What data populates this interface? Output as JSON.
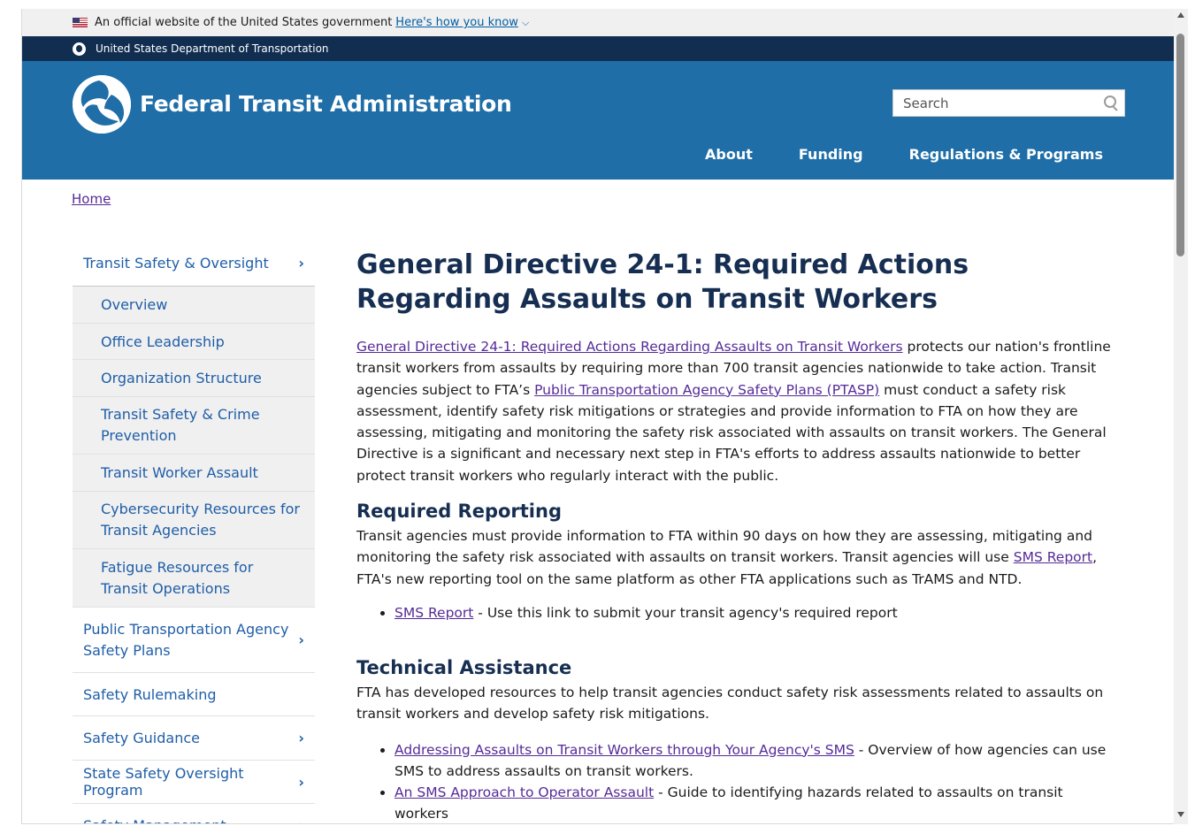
{
  "banner": {
    "official_text": "An official website of the United States government",
    "how_link": "Here's how you know"
  },
  "agency_bar": {
    "text": "United States Department of Transportation"
  },
  "header": {
    "site_name": "Federal Transit Administration",
    "search_placeholder": "Search",
    "nav": [
      "About",
      "Funding",
      "Regulations & Programs"
    ]
  },
  "breadcrumb": {
    "home": "Home"
  },
  "sidebar": {
    "section": "Transit Safety & Oversight",
    "subitems": [
      "Overview",
      "Office Leadership",
      "Organization Structure",
      "Transit Safety & Crime Prevention",
      "Transit Worker Assault",
      "Cybersecurity Resources for Transit Agencies",
      "Fatigue Resources for Transit Operations"
    ],
    "items": [
      {
        "label": "Public Transportation Agency Safety Plans",
        "has_children": true
      },
      {
        "label": "Safety Rulemaking",
        "has_children": false
      },
      {
        "label": "Safety Guidance",
        "has_children": true
      },
      {
        "label": "State Safety Oversight Program",
        "has_children": true
      },
      {
        "label": "Safety Management",
        "has_children": true
      }
    ]
  },
  "content": {
    "title": "General Directive 24-1: Required Actions Regarding Assaults on Transit Workers",
    "intro_link": "General Directive 24-1: Required Actions Regarding Assaults on Transit Workers",
    "intro_1": " protects our nation's frontline transit workers from assaults by requiring more than 700 transit agencies nationwide to take action. Transit agencies subject to FTA’s ",
    "intro_link2": "Public Transportation Agency Safety Plans (PTASP)",
    "intro_2": " must conduct a safety risk assessment, identify safety risk mitigations or strategies and provide information to FTA on how they are assessing, mitigating and monitoring the safety risk associated with assaults on transit workers. The General Directive is a significant and necessary next step in FTA's efforts to address assaults nationwide to better protect transit workers who regularly interact with the public.",
    "h2_reporting": "Required Reporting",
    "reporting_1": "Transit agencies must provide information to FTA within 90 days on how they are assessing, mitigating and monitoring the safety risk associated with assaults on transit workers. Transit agencies will use ",
    "reporting_link": "SMS Report",
    "reporting_2": ", FTA's new reporting tool on the same platform as other FTA applications such as TrAMS and NTD.",
    "reporting_bullet_link": "SMS Report",
    "reporting_bullet_text": " - Use this link to submit your transit agency's required report",
    "h2_ta": "Technical Assistance",
    "ta_text": "FTA has developed resources to help transit agencies conduct safety risk assessments related to assaults on transit workers and develop safety risk mitigations.",
    "ta_bullets": [
      {
        "link": "Addressing Assaults on Transit Workers through Your Agency's SMS",
        "text": " - Overview of how agencies can use SMS to address assaults on transit workers."
      },
      {
        "link": "An SMS Approach to Operator Assault",
        "text": " - Guide to identifying hazards related to assaults on transit workers"
      }
    ]
  }
}
